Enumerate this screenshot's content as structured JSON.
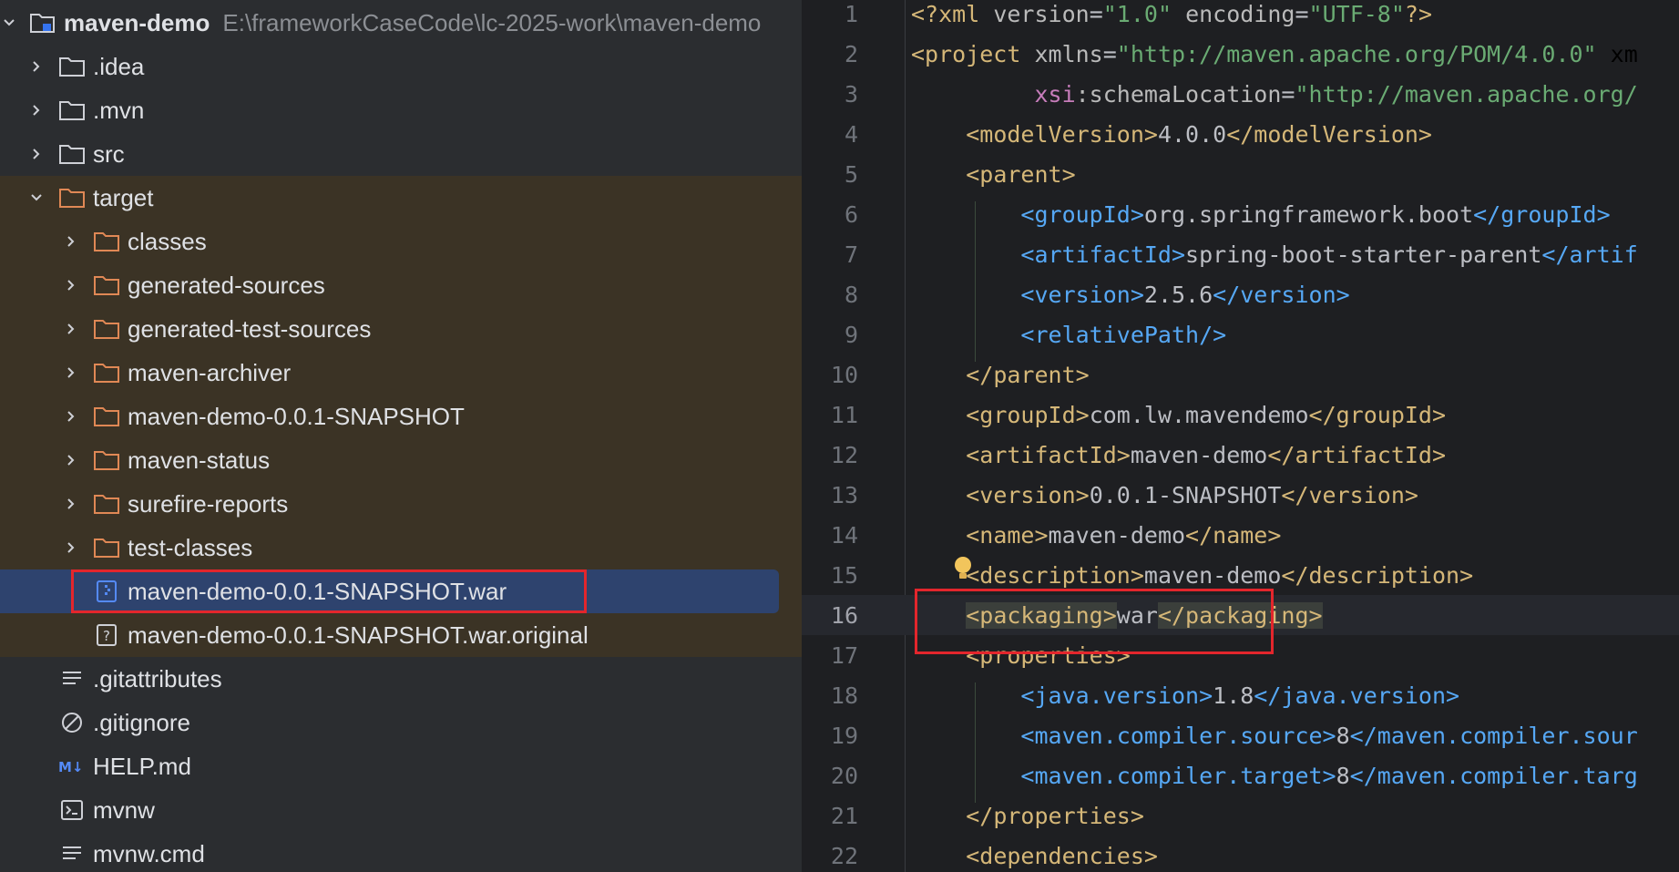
{
  "project_tree": {
    "root": {
      "name": "maven-demo",
      "path": "E:\\frameworkCaseCode\\lc-2025-work\\maven-demo"
    },
    "items": [
      {
        "label": ".idea",
        "type": "folder"
      },
      {
        "label": ".mvn",
        "type": "folder"
      },
      {
        "label": "src",
        "type": "folder"
      },
      {
        "label": "target",
        "type": "folder-open-excluded"
      },
      {
        "label": "classes",
        "type": "folder-excluded"
      },
      {
        "label": "generated-sources",
        "type": "folder-excluded"
      },
      {
        "label": "generated-test-sources",
        "type": "folder-excluded"
      },
      {
        "label": "maven-archiver",
        "type": "folder-excluded"
      },
      {
        "label": "maven-demo-0.0.1-SNAPSHOT",
        "type": "folder-excluded"
      },
      {
        "label": "maven-status",
        "type": "folder-excluded"
      },
      {
        "label": "surefire-reports",
        "type": "folder-excluded"
      },
      {
        "label": "test-classes",
        "type": "folder-excluded"
      },
      {
        "label": "maven-demo-0.0.1-SNAPSHOT.war",
        "type": "archive-file",
        "selected": true
      },
      {
        "label": "maven-demo-0.0.1-SNAPSHOT.war.original",
        "type": "unknown-file"
      },
      {
        "label": ".gitattributes",
        "type": "text-file"
      },
      {
        "label": ".gitignore",
        "type": "ignore-file"
      },
      {
        "label": "HELP.md",
        "type": "markdown-file"
      },
      {
        "label": "mvnw",
        "type": "shell-file"
      },
      {
        "label": "mvnw.cmd",
        "type": "text-file"
      }
    ]
  },
  "editor": {
    "current_line": 16,
    "lines": [
      {
        "n": "1",
        "text": "<?xml version=\"1.0\" encoding=\"UTF-8\"?>"
      },
      {
        "n": "2",
        "text": "<project xmlns=\"http://maven.apache.org/POM/4.0.0\" xm"
      },
      {
        "n": "3",
        "text": "         xsi:schemaLocation=\"http://maven.apache.org/"
      },
      {
        "n": "4",
        "text": "    <modelVersion>4.0.0</modelVersion>"
      },
      {
        "n": "5",
        "text": "    <parent>"
      },
      {
        "n": "6",
        "text": "        <groupId>org.springframework.boot</groupId>"
      },
      {
        "n": "7",
        "text": "        <artifactId>spring-boot-starter-parent</artif"
      },
      {
        "n": "8",
        "text": "        <version>2.5.6</version>"
      },
      {
        "n": "9",
        "text": "        <relativePath/>"
      },
      {
        "n": "10",
        "text": "    </parent>"
      },
      {
        "n": "11",
        "text": "    <groupId>com.lw.mavendemo</groupId>"
      },
      {
        "n": "12",
        "text": "    <artifactId>maven-demo</artifactId>"
      },
      {
        "n": "13",
        "text": "    <version>0.0.1-SNAPSHOT</version>"
      },
      {
        "n": "14",
        "text": "    <name>maven-demo</name>"
      },
      {
        "n": "15",
        "text": "    <description>maven-demo</description>"
      },
      {
        "n": "16",
        "text": "    <packaging>war</packaging>"
      },
      {
        "n": "17",
        "text": "    <properties>"
      },
      {
        "n": "18",
        "text": "        <java.version>1.8</java.version>"
      },
      {
        "n": "19",
        "text": "        <maven.compiler.source>8</maven.compiler.sour"
      },
      {
        "n": "20",
        "text": "        <maven.compiler.target>8</maven.compiler.targ"
      },
      {
        "n": "21",
        "text": "    </properties>"
      },
      {
        "n": "22",
        "text": "    <dependencies>"
      }
    ]
  },
  "colors": {
    "tag_child": "#56a8f5",
    "tag_level1": "#d5b778",
    "string": "#6aab73",
    "text": "#bcbec4",
    "selection": "#2e436e",
    "excluded_bg": "#3b3325",
    "annotation_red": "#e3262c"
  }
}
